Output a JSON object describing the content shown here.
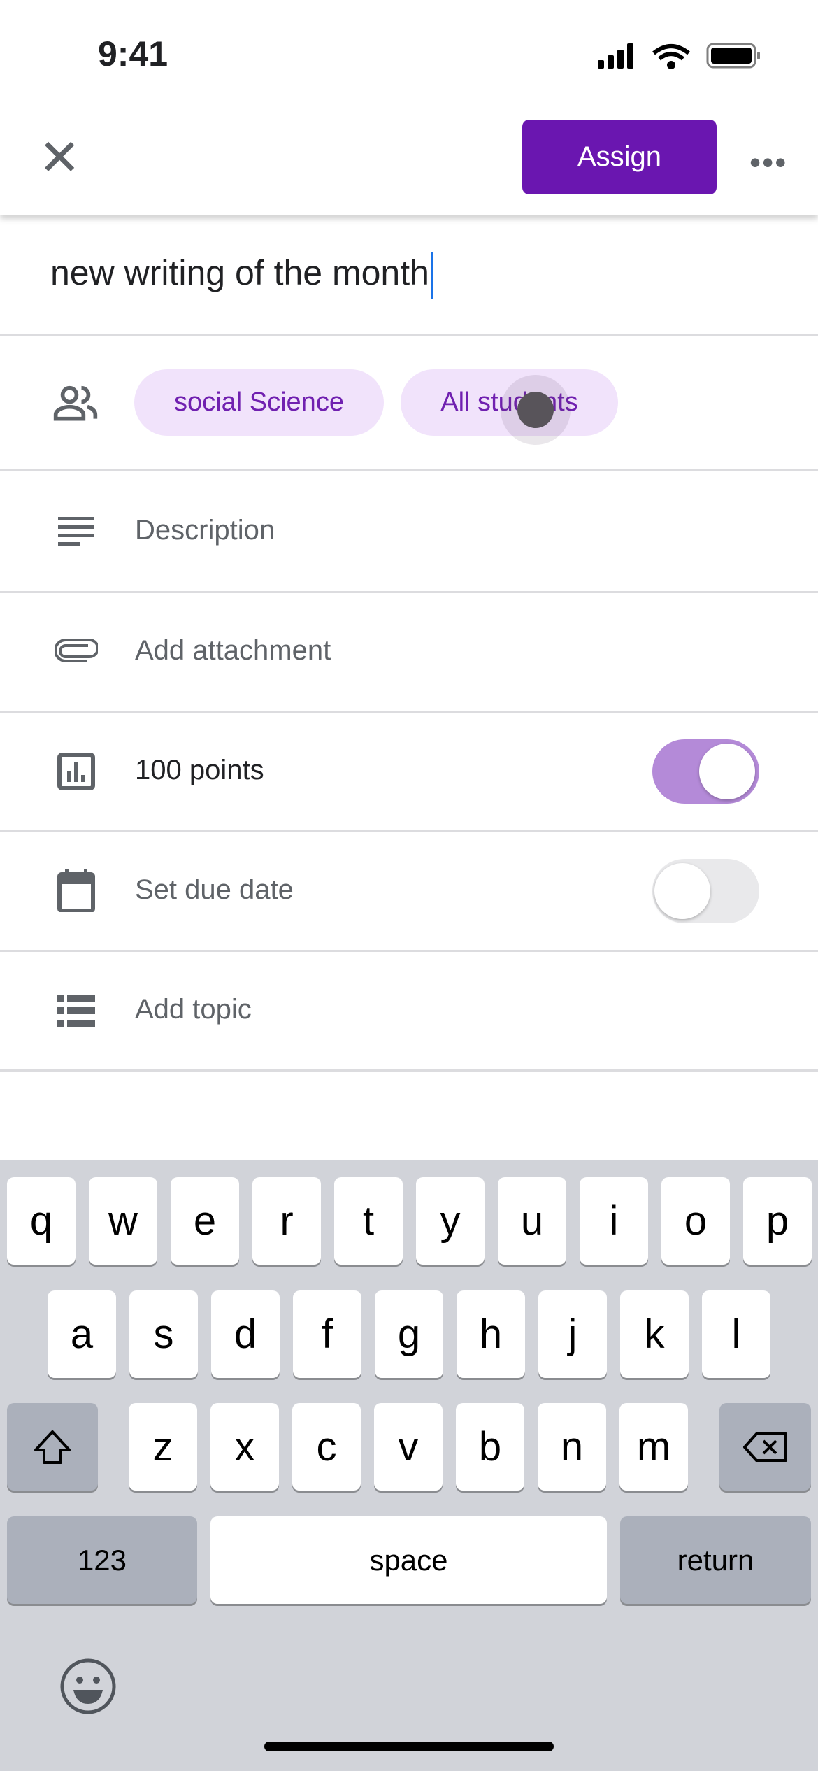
{
  "status": {
    "time": "9:41"
  },
  "header": {
    "assign_label": "Assign"
  },
  "title_value": "new writing of the month",
  "chips": [
    "social Science",
    "All students"
  ],
  "rows": {
    "description": "Description",
    "attachment": "Add attachment",
    "points": "100 points",
    "due_date": "Set due date",
    "topic": "Add topic"
  },
  "toggles": {
    "points_on": true,
    "due_date_on": false
  },
  "colors": {
    "accent": "#6a16b0",
    "chip_bg": "#f1e3fb",
    "toggle_on": "#b48ad8"
  },
  "keyboard": {
    "row1": [
      "q",
      "w",
      "e",
      "r",
      "t",
      "y",
      "u",
      "i",
      "o",
      "p"
    ],
    "row2": [
      "a",
      "s",
      "d",
      "f",
      "g",
      "h",
      "j",
      "k",
      "l"
    ],
    "row3": [
      "z",
      "x",
      "c",
      "v",
      "b",
      "n",
      "m"
    ],
    "numbers": "123",
    "space": "space",
    "return": "return"
  }
}
